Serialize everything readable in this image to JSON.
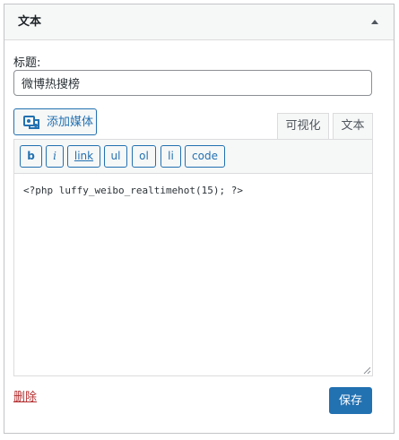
{
  "widget": {
    "title": "文本",
    "field_label": "标题:",
    "title_value": "微博热搜榜",
    "add_media_label": "添加媒体",
    "tabs": [
      "可视化",
      "文本"
    ],
    "quicktags": [
      "b",
      "i",
      "link",
      "ul",
      "ol",
      "li",
      "code"
    ],
    "content": "<?php luffy_weibo_realtimehot(15); ?>",
    "delete_label": "删除",
    "save_label": "保存"
  },
  "colors": {
    "accent": "#2271b1",
    "delete": "#b32d2e",
    "header_bg": "#f6f7f7",
    "border": "#c3c4c7"
  },
  "icons": [
    "collapse-arrow-icon",
    "media-icon",
    "resize-grip-icon"
  ]
}
